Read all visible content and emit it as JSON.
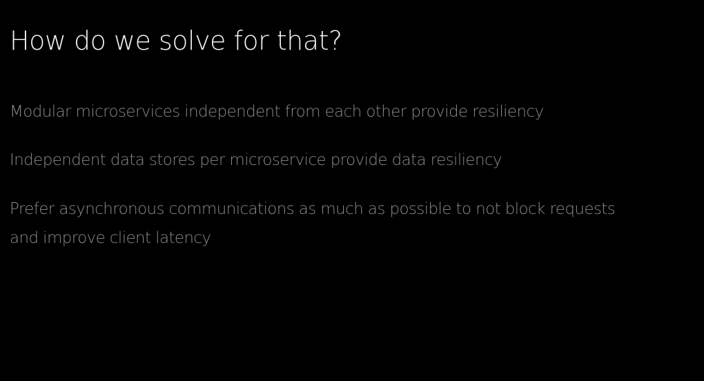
{
  "slide": {
    "title": "How do we solve for that?",
    "bullets": [
      "Modular microservices independent from each other provide resiliency",
      "Independent data stores per microservice provide data resiliency",
      "Prefer asynchronous communications as much as possible to not block requests and improve client latency"
    ]
  },
  "colors": {
    "background": "#000000",
    "title": "#f2f2f2",
    "body_text": "#8a8a8a"
  }
}
